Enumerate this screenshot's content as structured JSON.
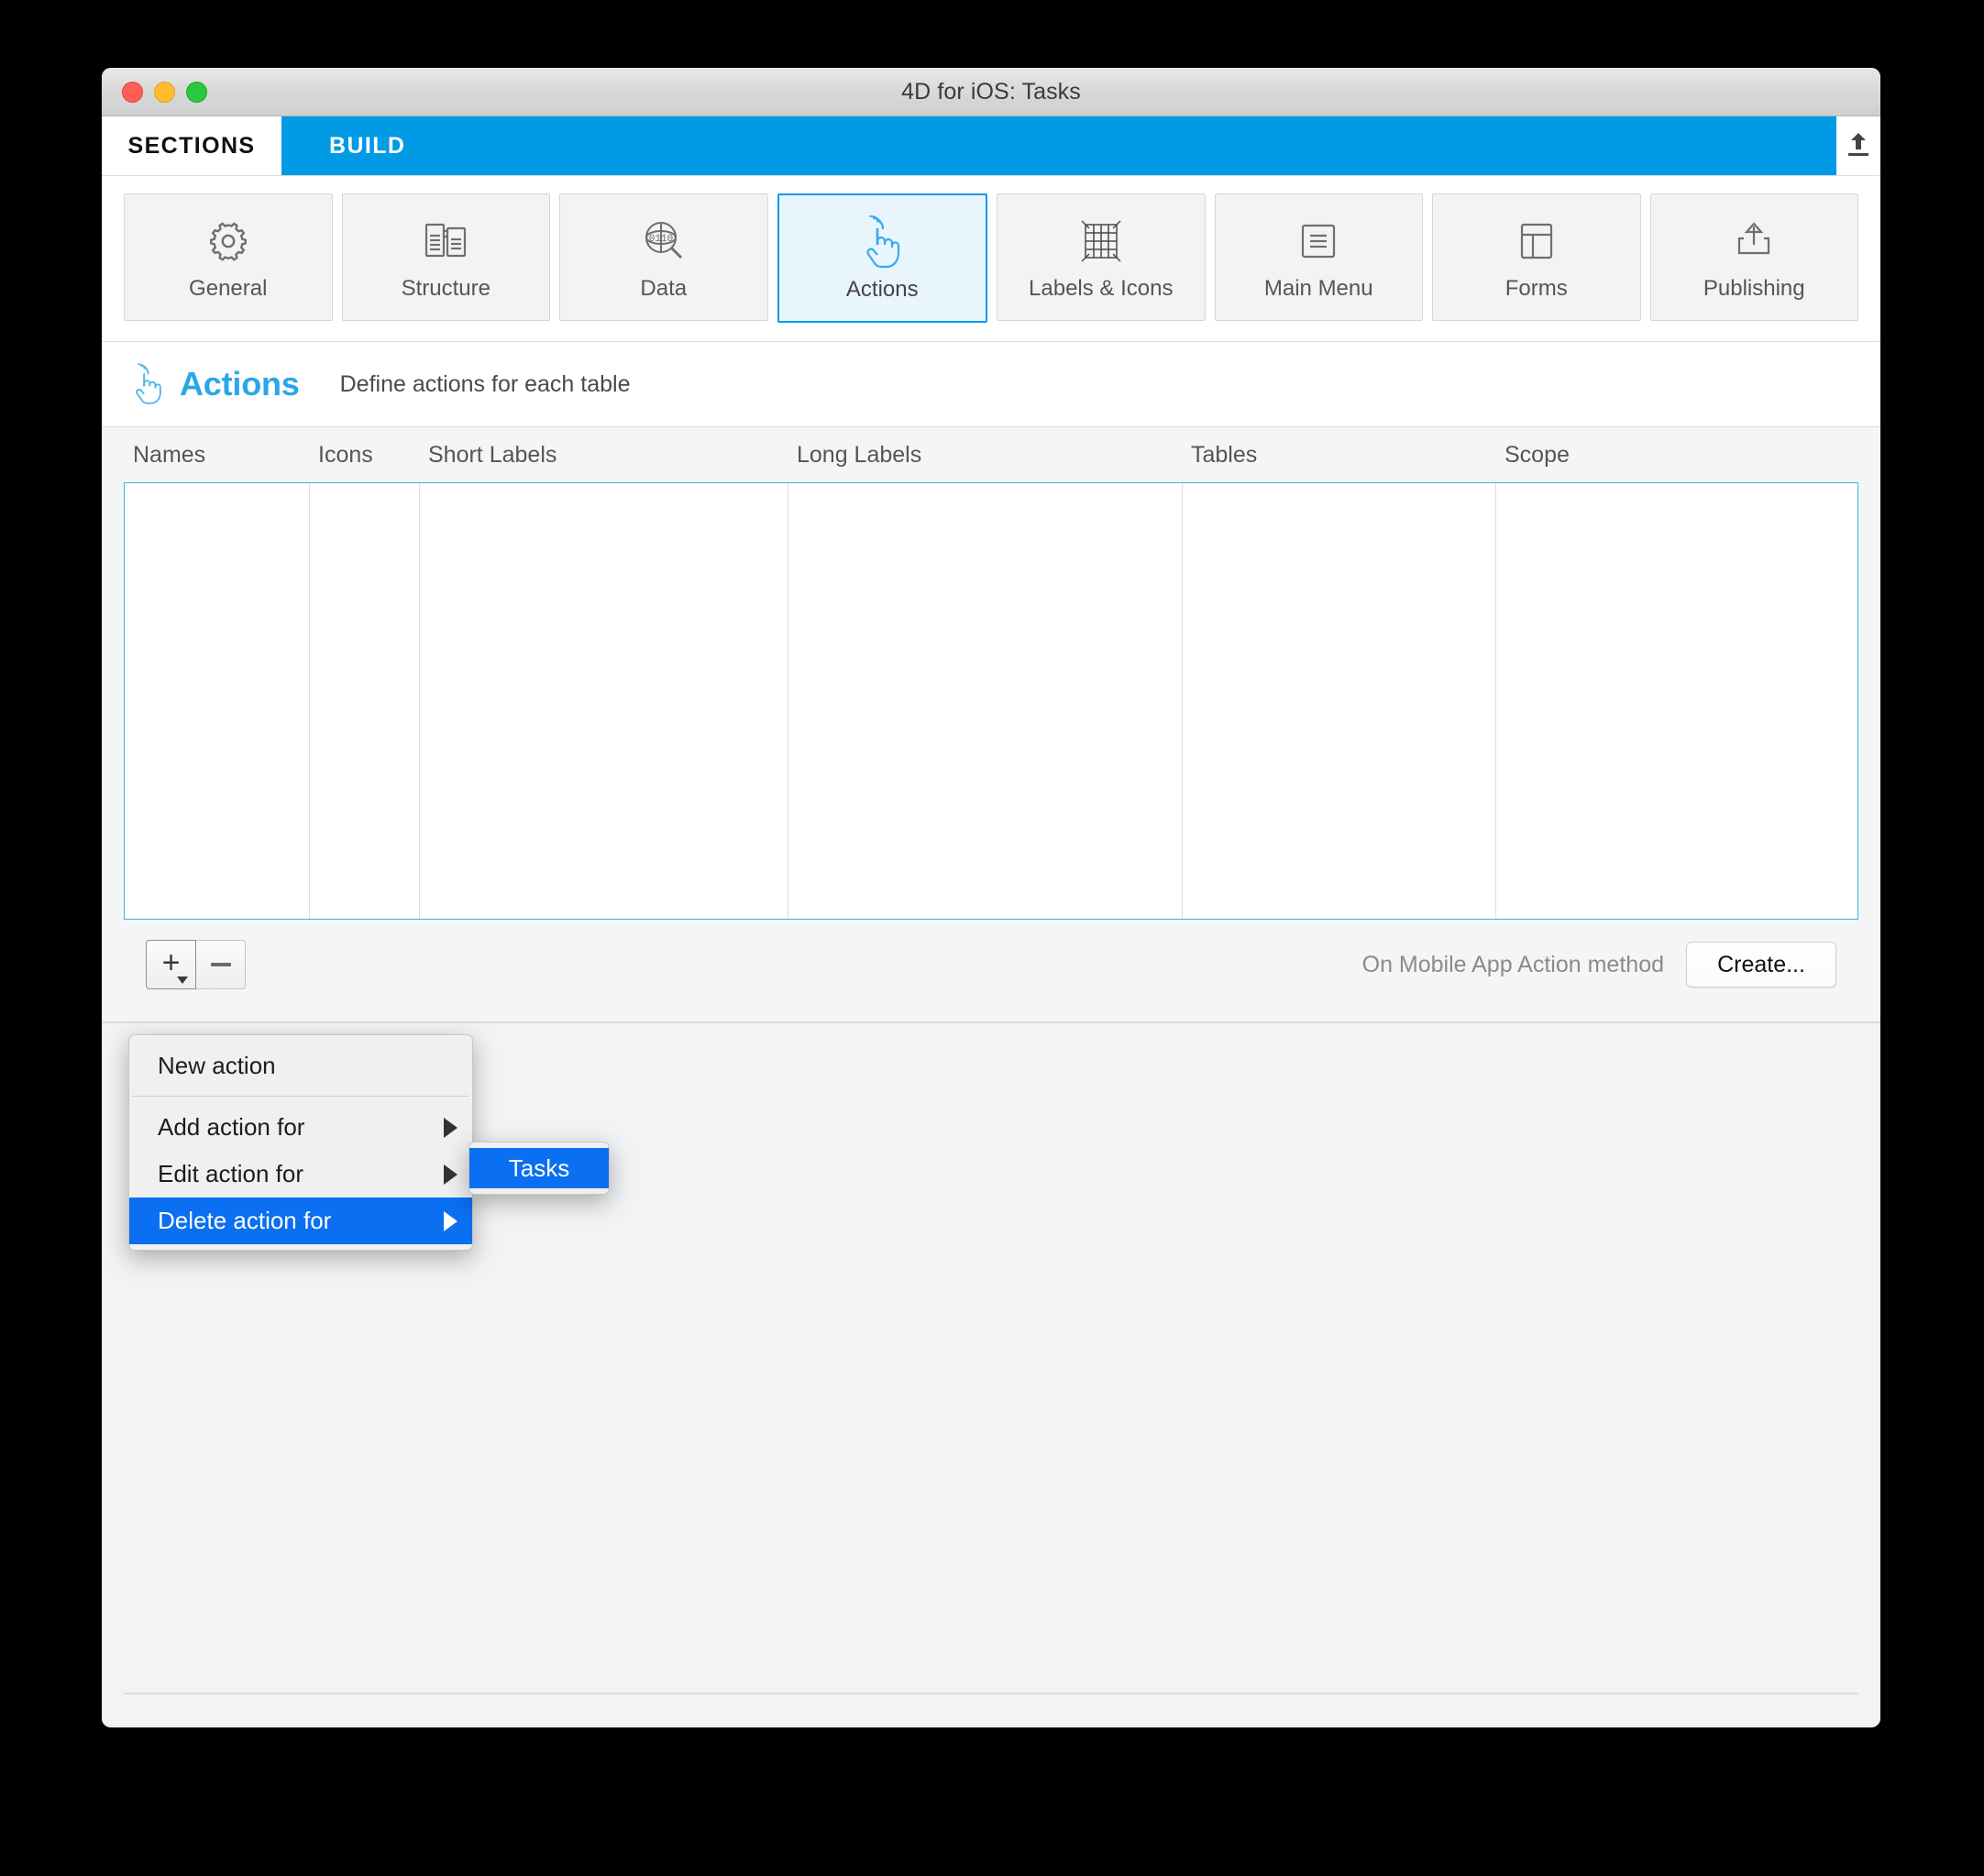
{
  "window": {
    "title": "4D for iOS: Tasks",
    "traffic_lights": [
      "close-button",
      "minimize-button",
      "zoom-button"
    ]
  },
  "tabbar": {
    "tabs": [
      {
        "label": "SECTIONS",
        "active": true
      },
      {
        "label": "BUILD",
        "active": false
      }
    ],
    "upload_icon": "upload-icon"
  },
  "toolbar": {
    "tiles": [
      {
        "label": "General",
        "icon": "gear-icon",
        "active": false
      },
      {
        "label": "Structure",
        "icon": "structure-icon",
        "active": false
      },
      {
        "label": "Data",
        "icon": "data-search-icon",
        "active": false
      },
      {
        "label": "Actions",
        "icon": "tap-hand-icon",
        "active": true
      },
      {
        "label": "Labels & Icons",
        "icon": "labels-grid-icon",
        "active": false
      },
      {
        "label": "Main Menu",
        "icon": "menu-lines-icon",
        "active": false
      },
      {
        "label": "Forms",
        "icon": "forms-layout-icon",
        "active": false
      },
      {
        "label": "Publishing",
        "icon": "share-up-icon",
        "active": false
      }
    ]
  },
  "page_header": {
    "icon": "tap-hand-icon",
    "title": "Actions",
    "subtitle": "Define actions for each table"
  },
  "list": {
    "columns": [
      "Names",
      "Icons",
      "Short Labels",
      "Long Labels",
      "Tables",
      "Scope"
    ],
    "rows": []
  },
  "controls": {
    "add_button_label": "+",
    "add_button_has_menu": true,
    "remove_button_label": "−",
    "method_label": "On Mobile App Action method",
    "create_button_label": "Create..."
  },
  "menu": {
    "items": [
      {
        "label": "New action",
        "submenu": false,
        "highlighted": false
      },
      {
        "separator": true
      },
      {
        "label": "Add action for",
        "submenu": true,
        "highlighted": false
      },
      {
        "label": "Edit action for",
        "submenu": true,
        "highlighted": false
      },
      {
        "label": "Delete action for",
        "submenu": true,
        "highlighted": true
      }
    ]
  },
  "submenu": {
    "items": [
      {
        "label": "Tasks",
        "highlighted": true
      }
    ]
  },
  "colors": {
    "accent_blue": "#009ae5",
    "selection_blue": "#0a6ff0",
    "tile_active_fill": "#e8f5fd",
    "tile_active_border": "#0d9ae8",
    "header_title_blue": "#2ba6ea",
    "grid_border": "#3fb0e8"
  }
}
